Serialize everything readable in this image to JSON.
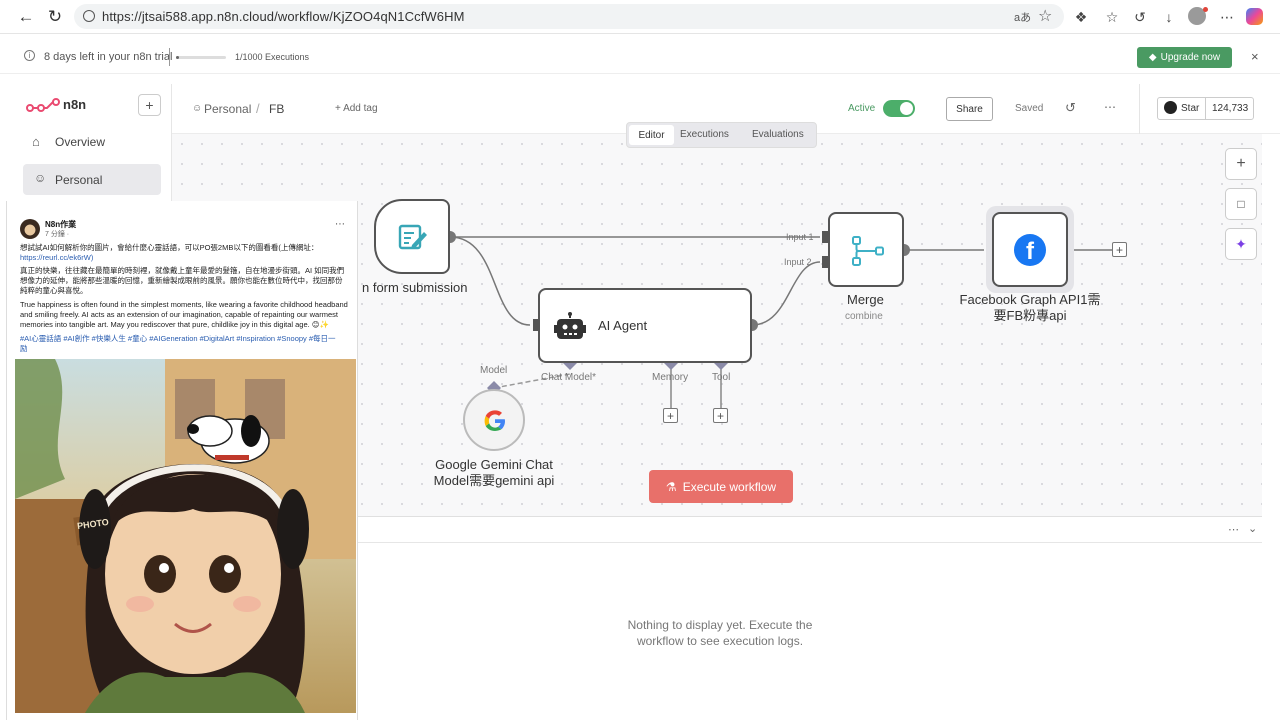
{
  "browser": {
    "url": "https://jtsai588.app.n8n.cloud/workflow/KjZOO4qN1CcfW6HM"
  },
  "trial": {
    "days_left": "8 days left in your n8n trial",
    "executions": "1/1000 Executions",
    "executions_progress": 0.001,
    "upgrade_label": "Upgrade now"
  },
  "sidebar": {
    "logo_text": "n8n",
    "items": [
      {
        "label": "Overview",
        "icon": "home-icon"
      },
      {
        "label": "Personal",
        "icon": "user-icon"
      }
    ]
  },
  "header": {
    "breadcrumb_owner": "Personal",
    "breadcrumb_sep": "/",
    "workflow_name": "FB",
    "add_tag": "+ Add tag",
    "active_label": "Active",
    "share_label": "Share",
    "saved_label": "Saved",
    "star_label": "Star",
    "star_count": "124,733"
  },
  "tabs": [
    "Editor",
    "Executions",
    "Evaluations"
  ],
  "nodes": {
    "form": {
      "label": "n form submission"
    },
    "ai_agent": {
      "label": "AI Agent",
      "ports": [
        "Chat Model*",
        "Memory",
        "Tool"
      ]
    },
    "gemini": {
      "label_line1": "Google Gemini Chat",
      "label_line2": "Model需要gemini api",
      "port": "Model"
    },
    "merge": {
      "label": "Merge",
      "sublabel": "combine",
      "input1": "Input 1",
      "input2": "Input 2"
    },
    "facebook": {
      "label_line1": "Facebook Graph API1需",
      "label_line2": "要FB粉專api"
    }
  },
  "execute_label": "Execute workflow",
  "logs": {
    "empty_line1": "Nothing to display yet. Execute the",
    "empty_line2": "workflow to see execution logs."
  },
  "fb_post": {
    "author": "N8n作業",
    "time": "7 分鐘 ·",
    "line1": "想試試AI如何解析你的圖片，會給什麼心靈話語，可以PO張2MB以下的圖看看(上傳網址：",
    "link": "https://reurl.cc/ek6rW)",
    "line2": "真正的快樂，往往藏在最簡單的時刻裡，就像戴上童年最愛的髮箍，自在地漫步街頭。AI 如同我們",
    "line3": "想像力的延伸，能將那些溫暖的回憶，重新繪製成眼前的風景。願你也能在數位時代中，找回那份",
    "line4": "純粹的童心與喜悅。",
    "line5": "True happiness is often found in the simplest moments, like wearing a favorite childhood headband",
    "line6": "and smiling freely. AI acts as an extension of our imagination, capable of repainting our warmest",
    "line7": "memories into tangible art. May you rediscover that pure, childlike joy in this digital age. 😊✨",
    "tags1": "#AI心靈話語 #AI創作 #快樂人生 #童心 #AIGeneration #DigitalArt #Inspiration #Snoopy #每日一",
    "tags2": "励",
    "photo_sign": "PHOTO"
  }
}
